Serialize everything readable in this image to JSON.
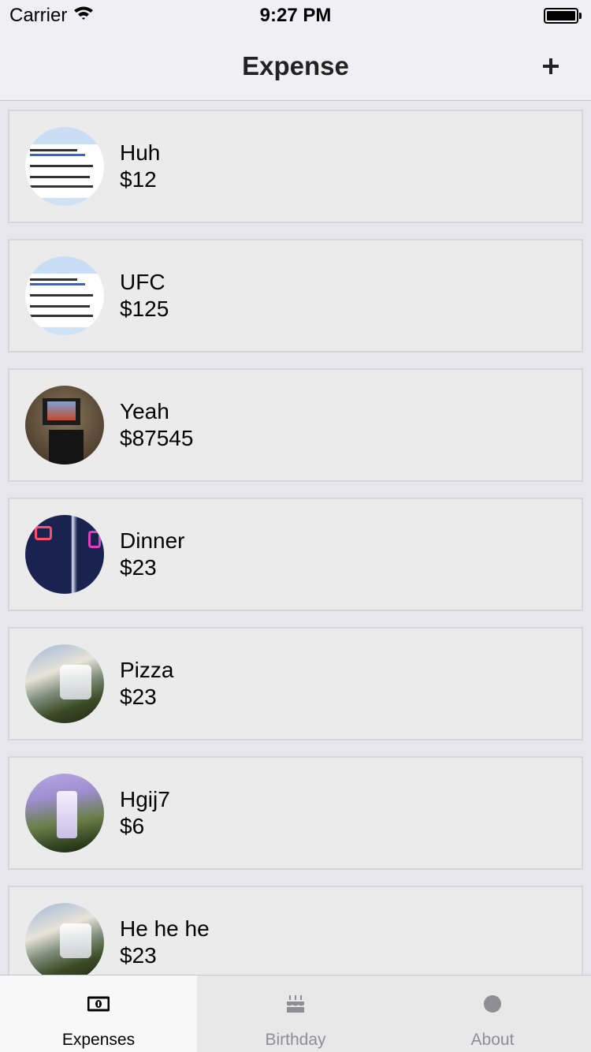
{
  "status_bar": {
    "carrier": "Carrier",
    "time": "9:27 PM"
  },
  "nav": {
    "title": "Expense"
  },
  "expenses": [
    {
      "name": "Huh",
      "amount": "$12"
    },
    {
      "name": "UFC",
      "amount": "$125"
    },
    {
      "name": "Yeah",
      "amount": "$87545"
    },
    {
      "name": "Dinner",
      "amount": "$23"
    },
    {
      "name": "Pizza",
      "amount": "$23"
    },
    {
      "name": "Hgij7",
      "amount": "$6"
    },
    {
      "name": "He he he",
      "amount": "$23"
    }
  ],
  "tabs": [
    {
      "label": "Expenses",
      "icon": "money-icon",
      "active": true
    },
    {
      "label": "Birthday",
      "icon": "birthday-cake-icon",
      "active": false
    },
    {
      "label": "About",
      "icon": "circle-icon",
      "active": false
    }
  ],
  "colors": {
    "nav_background": "#efeff4",
    "card_background": "#ebebeb",
    "tab_active_label": "#000000",
    "tab_inactive_label": "#8e8e93"
  }
}
